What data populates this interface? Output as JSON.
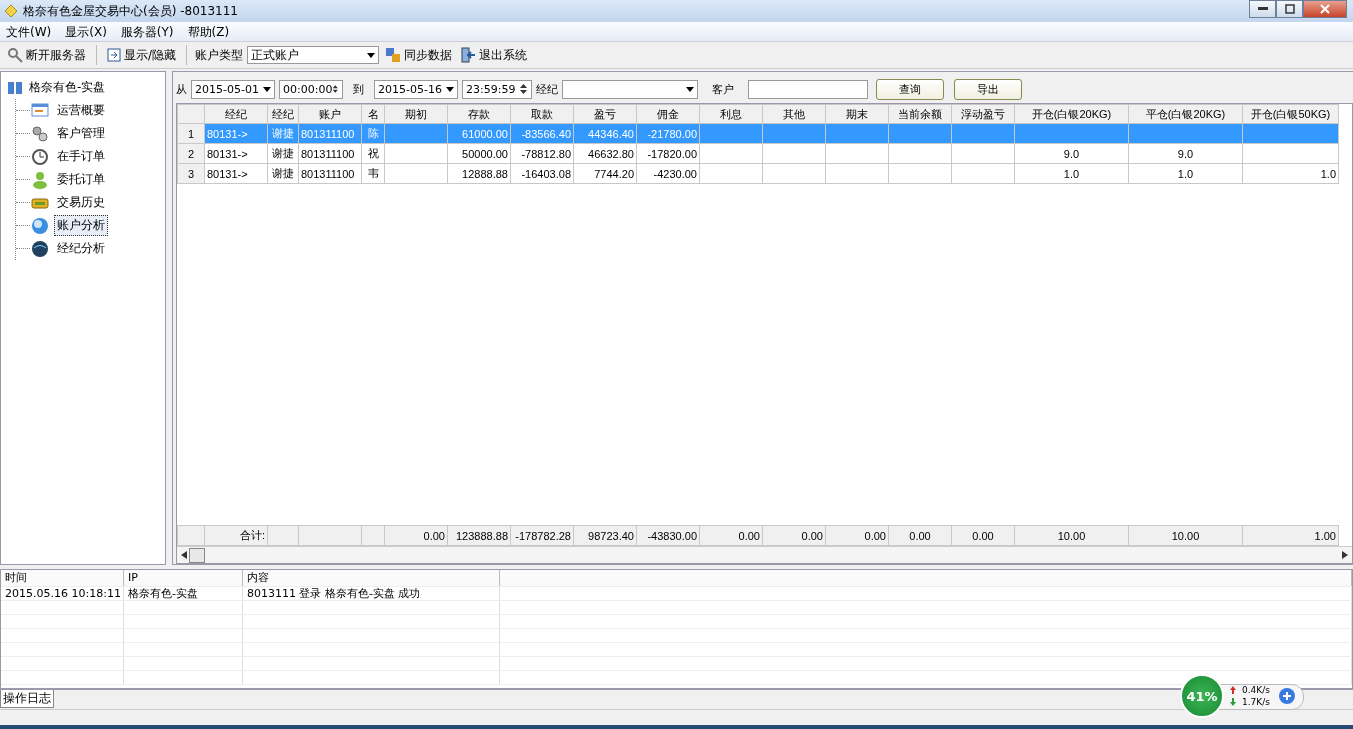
{
  "window": {
    "title": "格奈有色金屋交易中心(会员) -8013111"
  },
  "menu": [
    "文件(W)",
    "显示(X)",
    "服务器(Y)",
    "帮助(Z)"
  ],
  "toolbar": {
    "disconnect": "断开服务器",
    "toggle": "显示/隐藏",
    "account_type_label": "账户类型",
    "account_type_value": "正式账户",
    "sync": "同步数据",
    "exit": "退出系统"
  },
  "sidebar": {
    "root": {
      "label": "格奈有色-实盘",
      "children": [
        {
          "label": "运营概要",
          "selected": false
        },
        {
          "label": "客户管理",
          "selected": false
        },
        {
          "label": "在手订单",
          "selected": false
        },
        {
          "label": "委托订单",
          "selected": false
        },
        {
          "label": "交易历史",
          "selected": false
        },
        {
          "label": "账户分析",
          "selected": true
        },
        {
          "label": "经纪分析",
          "selected": false
        }
      ]
    }
  },
  "filter": {
    "from_label": "从",
    "from_date": "2015-05-01",
    "from_time": "00:00:00",
    "to_label": "到",
    "to_date": "2015-05-16",
    "to_time": "23:59:59",
    "broker_label": "经纪",
    "client_label": "客户",
    "query_button": "查询",
    "export_button": "导出"
  },
  "table": {
    "columns": [
      "经纪",
      "经纪",
      "账户",
      "名",
      "期初",
      "存款",
      "取款",
      "盈亏",
      "佣金",
      "利息",
      "其他",
      "期末",
      "当前余额",
      "浮动盈亏",
      "开仓(白银20KG)",
      "平仓(白银20KG)",
      "开仓(白银50KG)"
    ],
    "rows": [
      {
        "index": "1",
        "selected": true,
        "cells": [
          "80131->",
          "谢捷",
          "801311100",
          "陈",
          null,
          "61000.00",
          "-83566.40",
          "44346.40",
          "-21780.00",
          null,
          null,
          null,
          null,
          null,
          null,
          null,
          null
        ]
      },
      {
        "index": "2",
        "selected": false,
        "cells": [
          "80131->",
          "谢捷",
          "801311100",
          "祝",
          null,
          "50000.00",
          "-78812.80",
          "46632.80",
          "-17820.00",
          null,
          null,
          null,
          null,
          null,
          "9.0",
          "9.0",
          null
        ]
      },
      {
        "index": "3",
        "selected": false,
        "cells": [
          "80131->",
          "谢捷",
          "801311100",
          "韦",
          null,
          "12888.88",
          "-16403.08",
          "7744.20",
          "-4230.00",
          null,
          null,
          null,
          null,
          null,
          "1.0",
          "1.0",
          "1.0"
        ]
      }
    ],
    "totals": {
      "label": "合计:",
      "values": [
        "0.00",
        "123888.88",
        "-178782.28",
        "98723.40",
        "-43830.00",
        "0.00",
        "0.00",
        "0.00",
        "0.00",
        "0.00",
        "10.00",
        "10.00",
        "1.00"
      ]
    }
  },
  "log": {
    "columns": [
      "时间",
      "IP",
      "内容"
    ],
    "rows": [
      [
        "2015.05.16 10:18:11",
        "格奈有色-实盘",
        "8013111 登录 格奈有色-实盘 成功"
      ]
    ],
    "tab": "操作日志"
  },
  "net_widget": {
    "percent": "41%",
    "upload": "0.4K/s",
    "download": "1.7K/s"
  }
}
